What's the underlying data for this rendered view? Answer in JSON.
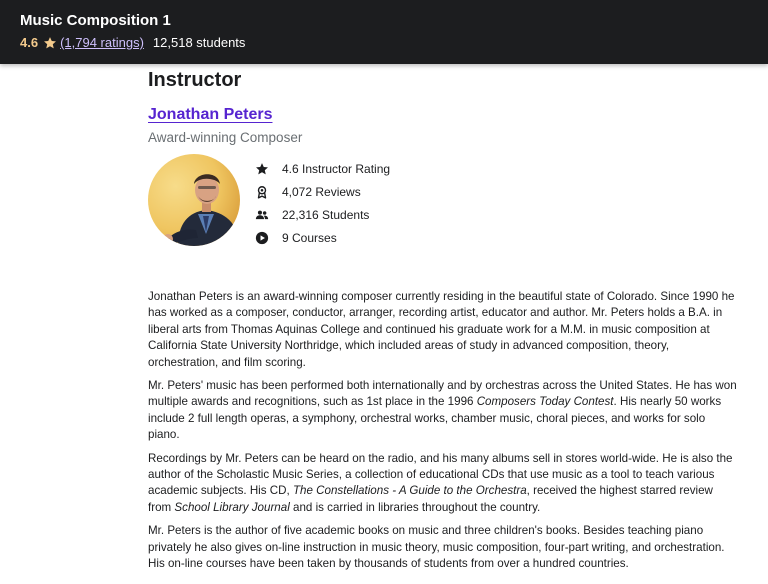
{
  "header": {
    "course_title": "Music Composition 1",
    "rating_value": "4.6",
    "ratings_count": "(1,794 ratings)",
    "students": "12,518 students"
  },
  "instructor": {
    "section_title": "Instructor",
    "name": "Jonathan Peters",
    "headline": "Award-winning Composer",
    "avatar_icon": "instructor-photo",
    "stats": [
      {
        "icon": "star-icon",
        "label": "4.6 Instructor Rating"
      },
      {
        "icon": "award-icon",
        "label": "4,072 Reviews"
      },
      {
        "icon": "users-icon",
        "label": "22,316 Students"
      },
      {
        "icon": "play-circle-icon",
        "label": "9 Courses"
      }
    ],
    "bio": [
      {
        "text": "Jonathan Peters is an award-winning composer currently residing in the beautiful state of Colorado. Since 1990 he has worked as a composer, conductor, arranger, recording artist, educator and author. Mr. Peters holds a B.A. in liberal arts from Thomas Aquinas College and continued his graduate work for a M.M. in music composition at California State University Northridge, which included areas of study in advanced composition, theory, orchestration, and film scoring."
      },
      {
        "before": "Mr. Peters' music has been performed both internationally and by orchestras across the United States. He has won multiple awards and recognitions, such as 1st place in the 1996 ",
        "em": "Composers Today Contest",
        "after": ". His nearly 50 works include 2 full length operas, a symphony, orchestral works, chamber music, choral pieces, and works for solo piano."
      },
      {
        "before": "Recordings by Mr. Peters can be heard on the radio, and his many albums sell in stores world-wide. He is also the author of the Scholastic Music Series, a collection of educational CDs that use music as a tool to teach various academic subjects. His CD, ",
        "em": "The Constellations - A Guide to the Orchestra",
        "mid": ", received the highest starred review from ",
        "em2": "School Library Journal",
        "after": " and is carried in libraries throughout the country."
      },
      {
        "text": "Mr. Peters is the author of five academic books on music and three children's books. Besides teaching piano privately he also gives on-line instruction in music theory, music composition, four-part writing, and orchestration. His on-line courses have been taken by thousands of students from over a hundred countries."
      }
    ]
  },
  "colors": {
    "header_bg": "#1c1d1f",
    "rating_gold": "#f3ca8c",
    "link_purple": "#5624d0",
    "ratings_link": "#cec0fc"
  }
}
